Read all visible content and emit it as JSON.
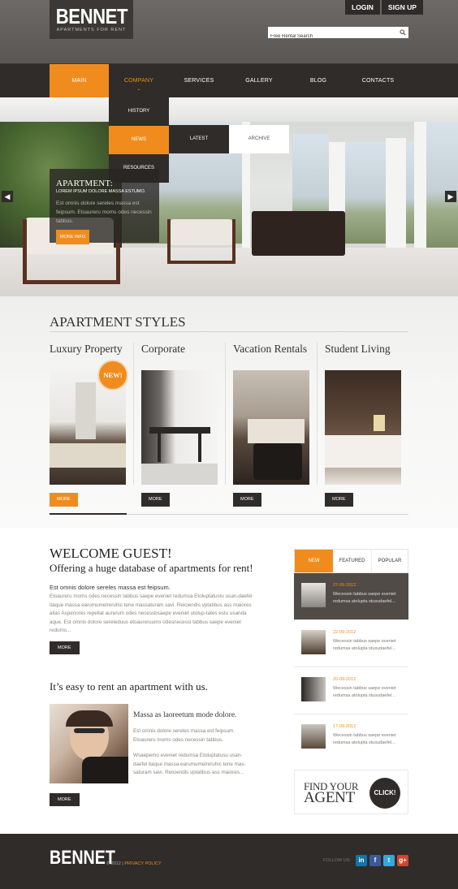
{
  "header": {
    "logo_name": "BENNET",
    "logo_tagline": "APARTMENTS FOR RENT",
    "login_label": "LOGIN",
    "signup_label": "SIGN UP",
    "search_placeholder": "Free Rental Search"
  },
  "nav": {
    "items": [
      {
        "label": "MAIN"
      },
      {
        "label": "COMPANY"
      },
      {
        "label": "SERVICES"
      },
      {
        "label": "GALLERY"
      },
      {
        "label": "BLOG"
      },
      {
        "label": "CONTACTS"
      }
    ],
    "active_index": 0
  },
  "dropdown": {
    "items": [
      {
        "label": "HISTORY"
      },
      {
        "label": "NEWS"
      },
      {
        "label": "RESOURCES"
      }
    ],
    "submenu": [
      {
        "label": "LATEST"
      },
      {
        "label": "ARCHIVE"
      }
    ]
  },
  "slider": {
    "title": "APARTMENT:",
    "subtitle": "LOREM IPSUM DOLORE MASSA ESTUMO.",
    "text": "Est omnis dolore sereles massa est feipsum. Etoaureru moms odes necessin tabbus.",
    "button": "MORE INFO"
  },
  "styles": {
    "title": "APARTMENT STYLES",
    "badge": "NEW!",
    "cards": [
      {
        "title": "Luxury Property",
        "more": "MORE"
      },
      {
        "title": "Corporate",
        "more": "MORE"
      },
      {
        "title": "Vacation Rentals",
        "more": "MORE"
      },
      {
        "title": "Student Living",
        "more": "MORE"
      }
    ]
  },
  "welcome": {
    "title": "WELCOME GUEST!",
    "subtitle": "Offering a huge database of apartments for rent!",
    "lead": "Est omnis dolore sereles massa est feipsum.",
    "body": "Etoaureru moms odes necessin tabbus saepe eveniet redumsa Etoluptatustu usan-daefel itaque massa earumumelreruhic tene massaturam savi. Reiciendis vptatibus ass maiores alias Aspenores repellat aurerum odes necessbsaepe eveniet utolup-tates estu usanda aque. Est omnis dolore sereleduus etoaureruums odesnecessi tabbus saepe eveniet redums...",
    "more": "MORE",
    "easy_title": "It’s easy to rent an apartment with us.",
    "person_title": "Massa as laoreetum mode dolore.",
    "person_text1": "Est omnis dolore sereles massa est feipsum. Etoaureru moms odes necessin tabbus.",
    "person_text2": "Wsaepemo eveniet redumsa Etoluptatusu usan-daefel itaque massa earumumelreruhic tene mas-saturam savi. Reiciendis vptatibus ass maiores...",
    "more2": "MORE"
  },
  "sidebar": {
    "tabs": [
      {
        "label": "NEW"
      },
      {
        "label": "FEATURED"
      },
      {
        "label": "POPULAR"
      }
    ],
    "news": [
      {
        "date": "27-09-2012",
        "text": "Wecessin tabbus saepe eveniet redumsa atolupta stusudaefel..."
      },
      {
        "date": "22-09-2012",
        "text": "Wecessin tabbus saepe eveniet redumsa atolupta stusudaefel..."
      },
      {
        "date": "20-09-2012",
        "text": "Wecessin tabbus saepe eveniet redumsa atolupta stusudaefel..."
      },
      {
        "date": "17-09-2012",
        "text": "Wecessin tabbus saepe eveniet redumsa atolupta stusudaefel..."
      }
    ],
    "agent_line1": "FIND YOUR",
    "agent_line2": "AGENT",
    "agent_button": "CLICK!"
  },
  "footer": {
    "logo": "BENNET",
    "copyright": "© 2012 |",
    "privacy": "PRIVACY POLICY",
    "follow": "FOLLOW US:",
    "social": [
      "in",
      "f",
      "t",
      "g+"
    ]
  },
  "colors": {
    "accent": "#f08c1e",
    "dark": "#2f2c2a",
    "linkedin": "#0e76a8",
    "facebook": "#3b5998",
    "twitter": "#33a8dc",
    "googleplus": "#d1452f"
  }
}
